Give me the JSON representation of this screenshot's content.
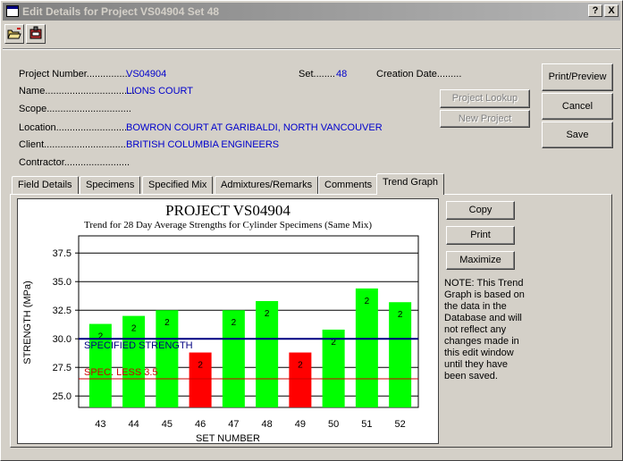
{
  "window": {
    "title": "Edit Details for Project VS04904 Set 48",
    "help_label": "?",
    "close_label": "X"
  },
  "toolbar": {
    "items": [
      {
        "icon": "open-folder-icon"
      },
      {
        "icon": "print-setup-icon"
      }
    ]
  },
  "project": {
    "number_label": "Project Number................",
    "number_value": "VS04904",
    "set_label": "Set........",
    "set_value": "48",
    "creation_label": "Creation Date.........",
    "name_label": "Name.................................",
    "name_value": "LIONS COURT",
    "scope_label": "Scope...............................",
    "location_label": "Location..........................",
    "location_value": "BOWRON COURT AT GARIBALDI, NORTH VANCOUVER",
    "client_label": "Client..............................",
    "client_value": "BRITISH COLUMBIA ENGINEERS",
    "contractor_label": "Contractor........................"
  },
  "buttons": {
    "project_lookup": "Project Lookup",
    "new_project": "New Project",
    "print_preview": "Print/Preview",
    "cancel": "Cancel",
    "save": "Save",
    "copy": "Copy",
    "print": "Print",
    "maximize": "Maximize"
  },
  "tabs": [
    {
      "label": "Field Details"
    },
    {
      "label": "Specimens"
    },
    {
      "label": "Specified Mix"
    },
    {
      "label": "Admixtures/Remarks"
    },
    {
      "label": "Comments"
    },
    {
      "label": "Trend Graph"
    }
  ],
  "note": "NOTE: This Trend Graph is based on the data in the Database and will not reflect any changes made in this edit window until they have been saved.",
  "colors": {
    "bar_ok": "#00ff00",
    "bar_low": "#ff0000",
    "specified_line": "#000080",
    "spec_less_line": "#cc0000"
  },
  "chart_data": {
    "type": "bar",
    "title": "PROJECT VS04904",
    "subtitle": "Trend for 28 Day Average Strengths for Cylinder Specimens (Same Mix)",
    "xlabel": "SET NUMBER",
    "ylabel": "STRENGTH (MPa)",
    "categories": [
      "43",
      "44",
      "45",
      "46",
      "47",
      "48",
      "49",
      "50",
      "51",
      "52"
    ],
    "values": [
      31.3,
      32.0,
      32.5,
      28.8,
      32.5,
      33.3,
      28.8,
      30.8,
      34.4,
      33.2
    ],
    "labels": [
      "2",
      "2",
      "2",
      "2",
      "2",
      "2",
      "2",
      "2",
      "2",
      "2"
    ],
    "below_spec": [
      false,
      false,
      false,
      true,
      false,
      false,
      true,
      false,
      false,
      false
    ],
    "ylim": [
      24.0,
      39.0
    ],
    "yticks": [
      "25.0",
      "27.5",
      "30.0",
      "32.5",
      "35.0",
      "37.5"
    ],
    "grid": true,
    "reference_lines": [
      {
        "label": "SPECIFIED STRENGTH",
        "value": 30.0
      },
      {
        "label": "SPEC. LESS 3.5",
        "value": 26.5
      }
    ]
  }
}
